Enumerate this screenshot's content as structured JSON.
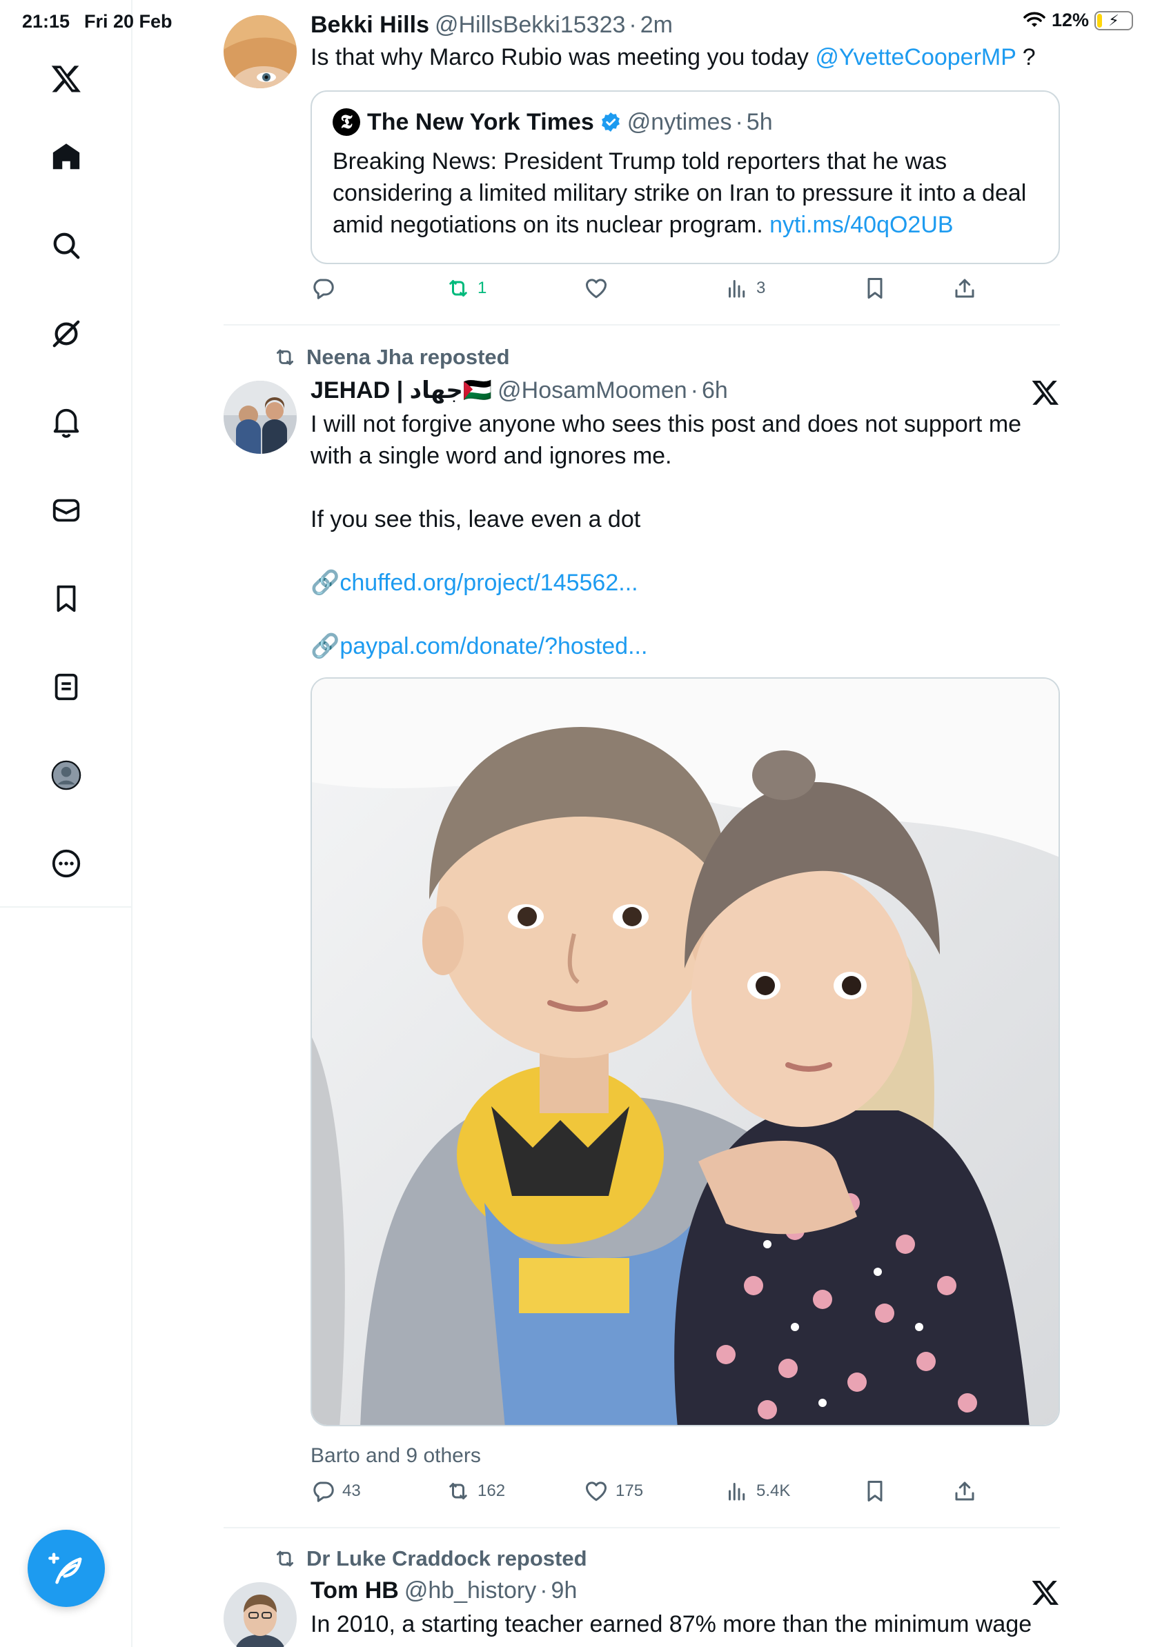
{
  "status_bar": {
    "time": "21:15",
    "date": "Fri 20 Feb",
    "battery": "12%"
  },
  "sidebar": {
    "items": [
      {
        "name": "x-logo"
      },
      {
        "name": "home"
      },
      {
        "name": "explore"
      },
      {
        "name": "grok"
      },
      {
        "name": "notifications"
      },
      {
        "name": "messages"
      },
      {
        "name": "bookmarks"
      },
      {
        "name": "lists"
      },
      {
        "name": "profile"
      },
      {
        "name": "more"
      }
    ],
    "compose": "compose"
  },
  "posts": [
    {
      "name": "Bekki Hills",
      "handle": "@HillsBekki15323",
      "time": "2m",
      "text": "Is that why Marco Rubio was meeting you today",
      "mention": "@YvetteCooperMP",
      "text_end": " ?",
      "quote": {
        "name": "The New York Times",
        "handle": "@nytimes",
        "time": "5h",
        "text": "Breaking News: President Trump told reporters that he was considering a limited military strike on Iran to pressure it into a deal amid negotiations on its nuclear program.",
        "link": "nyti.ms/40qO2UB"
      },
      "stats": {
        "replies": "",
        "reposts": "1",
        "likes": "",
        "views": "3"
      }
    },
    {
      "repost_label": "Neena Jha reposted",
      "name": "JEHAD | جهاد🇵🇸",
      "handle": "@HosamMoomen",
      "time": "6h",
      "text_1": "I will not forgive anyone who sees this post and does not support me with a single word and ignores me.",
      "text_2": "If you see this, leave even a dot",
      "link_1": "chuffed.org/project/145562...",
      "link_2": "paypal.com/donate/?hosted...",
      "link_icon": "🔗",
      "liked_by": "Barto and 9 others",
      "stats": {
        "replies": "43",
        "reposts": "162",
        "likes": "175",
        "views": "5.4K"
      }
    },
    {
      "repost_label": "Dr Luke Craddock reposted",
      "name": "Tom HB",
      "handle": "@hb_history",
      "time": "9h",
      "text": "In 2010, a starting teacher earned 87% more than the minimum wage"
    }
  ],
  "colors": {
    "accent": "#1d9bf0",
    "repost_green": "#00ba7c",
    "muted": "#536471"
  }
}
